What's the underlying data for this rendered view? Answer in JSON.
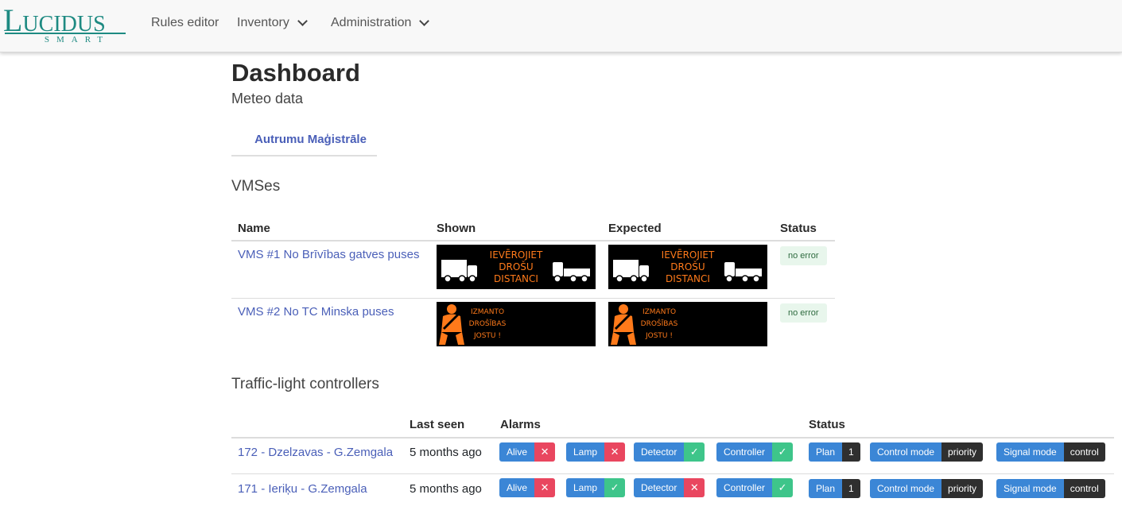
{
  "navbar": {
    "logo_main": "Lucidus",
    "logo_sub": "SMART",
    "items": [
      {
        "label": "Rules editor"
      },
      {
        "label": "Inventory"
      },
      {
        "label": "Administration"
      }
    ]
  },
  "page": {
    "title": "Dashboard",
    "subtitle": "Meteo data",
    "tab_label": "Autrumu Maģistrāle"
  },
  "vms": {
    "section_title": "VMSes",
    "headers": {
      "name": "Name",
      "shown": "Shown",
      "expected": "Expected",
      "status": "Status"
    },
    "rows": [
      {
        "name": "VMS #1 No Brīvības gatves puses",
        "sign_lines": [
          "IEVĒROJIET",
          "DROŠU",
          "DISTANCI"
        ],
        "status": "no error"
      },
      {
        "name": "VMS #2 No TC Minska puses",
        "sign_lines": [
          "IZMANTO",
          "DROŠĪBAS",
          "JOSTU !"
        ],
        "status": "no error"
      }
    ],
    "sign_text_color": "#ff7a1a"
  },
  "tlc": {
    "section_title": "Traffic-light controllers",
    "headers": {
      "name": "",
      "last_seen": "Last seen",
      "alarms": "Alarms",
      "status": "Status"
    },
    "rows": [
      {
        "name": "172 - Dzelzavas - G.Zemgala",
        "last_seen": "5 months ago",
        "alarms": [
          {
            "label": "Alive",
            "state": "error"
          },
          {
            "label": "Lamp",
            "state": "error"
          },
          {
            "label": "Detector",
            "state": "ok"
          },
          {
            "label": "Controller",
            "state": "ok"
          }
        ],
        "status": [
          {
            "label": "Plan",
            "value": "1"
          },
          {
            "label": "Control mode",
            "value": "priority"
          },
          {
            "label": "Signal mode",
            "value": "control"
          }
        ]
      },
      {
        "name": "171 - Ieriķu - G.Zemgala",
        "last_seen": "5 months ago",
        "alarms": [
          {
            "label": "Alive",
            "state": "error"
          },
          {
            "label": "Lamp",
            "state": "ok"
          },
          {
            "label": "Detector",
            "state": "error"
          },
          {
            "label": "Controller",
            "state": "ok"
          }
        ],
        "status": [
          {
            "label": "Plan",
            "value": "1"
          },
          {
            "label": "Control mode",
            "value": "priority"
          },
          {
            "label": "Signal mode",
            "value": "control"
          }
        ]
      }
    ]
  },
  "icons": {
    "ok": "check-icon",
    "error": "cross-icon",
    "dropdown": "chevron-down-icon"
  },
  "colors": {
    "brand": "#1e8a82",
    "link": "#4a5fb8",
    "badge_blue": "#3b86d6",
    "error": "#e9465f",
    "ok": "#3ec58a",
    "dark": "#2f2f2f"
  }
}
